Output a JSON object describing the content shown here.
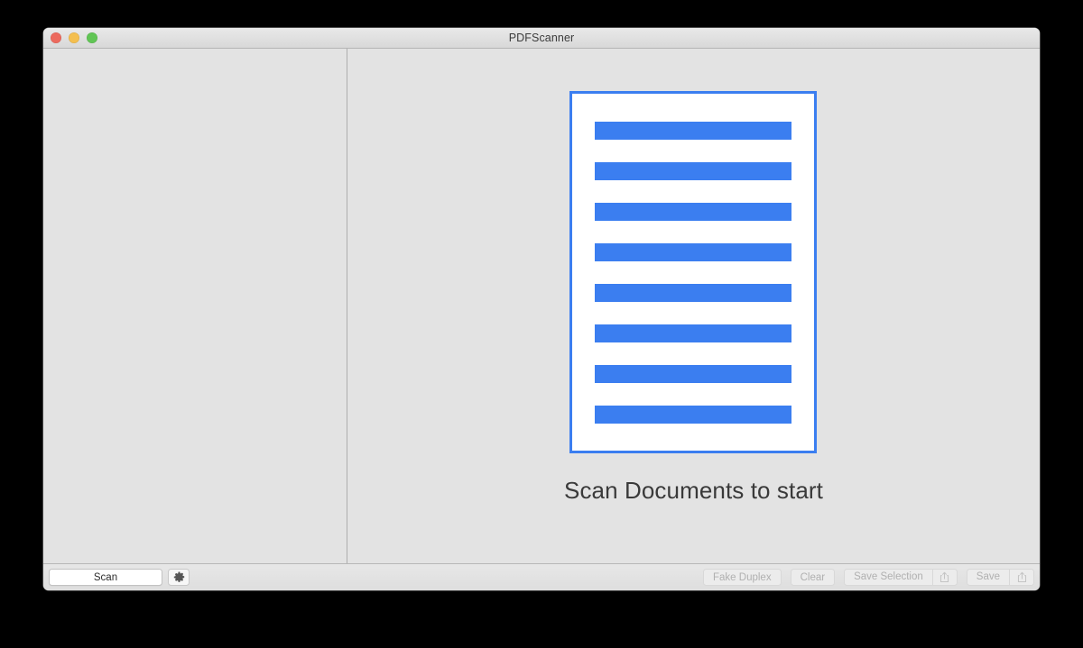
{
  "window": {
    "title": "PDFScanner",
    "traffic_lights": [
      {
        "name": "close",
        "color": "#ec6a5e"
      },
      {
        "name": "minimize",
        "color": "#f4bf4f"
      },
      {
        "name": "zoom",
        "color": "#61c555"
      }
    ]
  },
  "sidebar": {
    "items": []
  },
  "content": {
    "placeholder_text": "Scan Documents to start",
    "document_icon": {
      "icon_name": "document-placeholder-icon",
      "border_color": "#3b7ef0",
      "line_color": "#3b7ef0",
      "page_color": "#ffffff",
      "line_count": 8
    }
  },
  "toolbar": {
    "scan_label": "Scan",
    "settings_icon": "gear-icon",
    "fake_duplex_label": "Fake Duplex",
    "clear_label": "Clear",
    "save_selection_label": "Save Selection",
    "save_label": "Save",
    "share_icon": "share-icon"
  },
  "colors": {
    "accent": "#3b7ef0",
    "window_background": "#e3e3e3",
    "toolbar_background": "#e2e2e2",
    "disabled_text": "#b0b0b0",
    "text": "#3a3a3a"
  }
}
